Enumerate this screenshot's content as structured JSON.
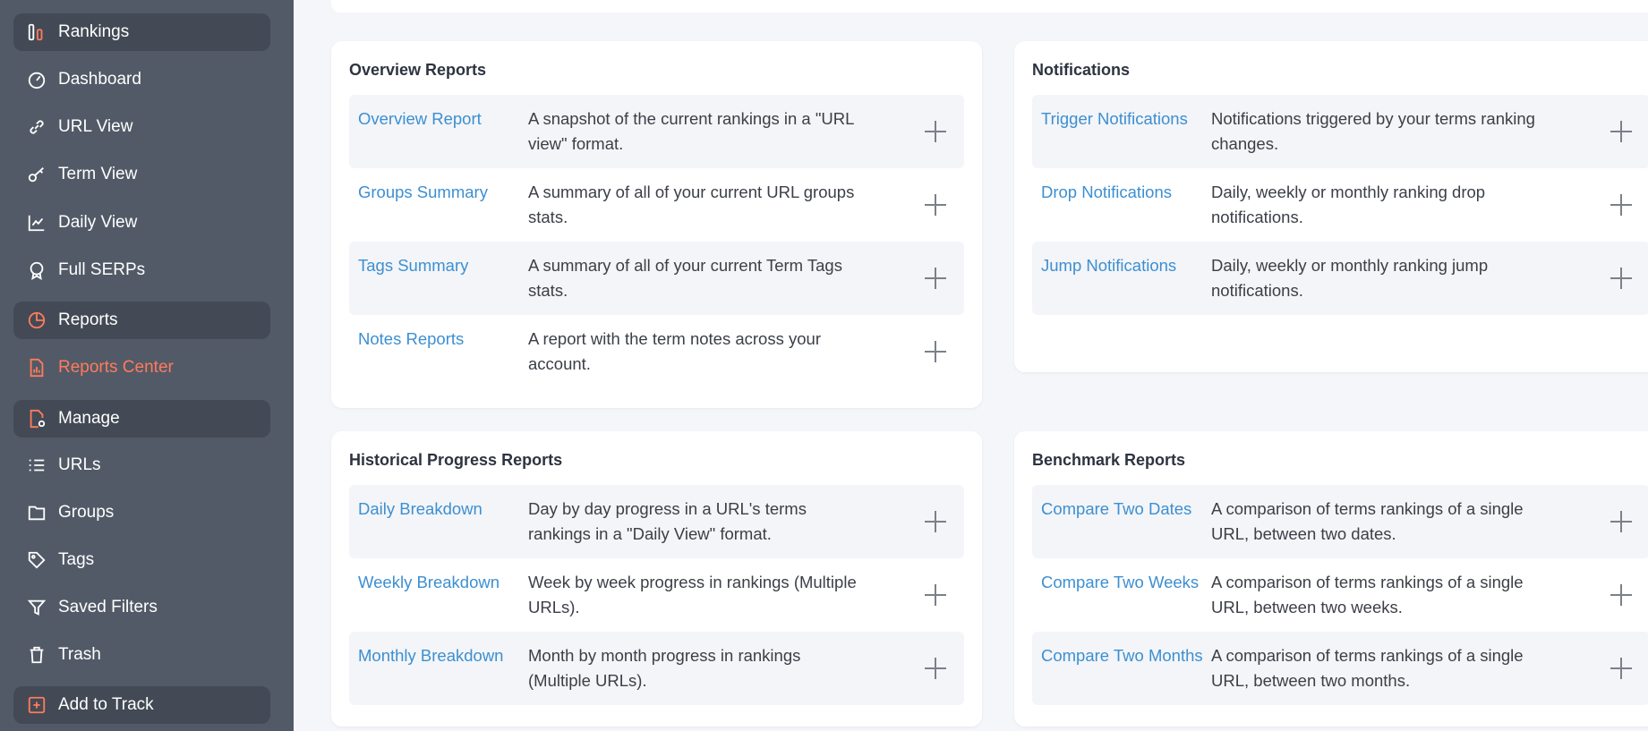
{
  "sidebar": {
    "items": [
      {
        "label": "Rankings",
        "icon": "rankings-icon"
      },
      {
        "label": "Dashboard",
        "icon": "dashboard-icon"
      },
      {
        "label": "URL View",
        "icon": "link-icon"
      },
      {
        "label": "Term View",
        "icon": "key-icon"
      },
      {
        "label": "Daily View",
        "icon": "chart-line-icon"
      },
      {
        "label": "Full SERPs",
        "icon": "serp-badge-icon"
      },
      {
        "label": "Reports",
        "icon": "pie-chart-icon"
      },
      {
        "label": "Reports Center",
        "icon": "report-document-icon"
      },
      {
        "label": "Manage",
        "icon": "manage-document-icon"
      },
      {
        "label": "URLs",
        "icon": "list-icon"
      },
      {
        "label": "Groups",
        "icon": "folder-icon"
      },
      {
        "label": "Tags",
        "icon": "tag-icon"
      },
      {
        "label": "Saved Filters",
        "icon": "filter-icon"
      },
      {
        "label": "Trash",
        "icon": "trash-icon"
      },
      {
        "label": "Add to Track",
        "icon": "add-square-icon"
      }
    ]
  },
  "colors": {
    "sidebar_bg": "#525a67",
    "sidebar_section_bg": "#434a55",
    "accent": "#ff7b5c",
    "link": "#3d8fd1"
  },
  "cards": {
    "overview": {
      "title": "Overview Reports",
      "rows": [
        {
          "link": "Overview Report",
          "desc": "A snapshot of the current rankings in a \"URL view\" format."
        },
        {
          "link": "Groups Summary",
          "desc": "A summary of all of your current URL groups stats."
        },
        {
          "link": "Tags Summary",
          "desc": "A summary of all of your current Term Tags stats."
        },
        {
          "link": "Notes Reports",
          "desc": "A report with the term notes across your account."
        }
      ]
    },
    "notifications": {
      "title": "Notifications",
      "rows": [
        {
          "link": "Trigger Notifications",
          "desc": "Notifications triggered by your terms ranking changes."
        },
        {
          "link": "Drop Notifications",
          "desc": "Daily, weekly or monthly ranking drop notifications."
        },
        {
          "link": "Jump Notifications",
          "desc": "Daily, weekly or monthly ranking jump notifications."
        }
      ]
    },
    "historical": {
      "title": "Historical Progress Reports",
      "rows": [
        {
          "link": "Daily Breakdown",
          "desc": "Day by day progress in a URL's terms rankings in a \"Daily View\" format."
        },
        {
          "link": "Weekly Breakdown",
          "desc": "Week by week progress in rankings (Multiple URLs)."
        },
        {
          "link": "Monthly Breakdown",
          "desc": "Month by month progress in rankings (Multiple URLs)."
        }
      ]
    },
    "benchmark": {
      "title": "Benchmark Reports",
      "rows": [
        {
          "link": "Compare Two Dates",
          "desc": "A comparison of terms rankings of a single URL, between two dates."
        },
        {
          "link": "Compare Two Weeks",
          "desc": "A comparison of terms rankings of a single URL, between two weeks."
        },
        {
          "link": "Compare Two Months",
          "desc": "A comparison of terms rankings of a single URL, between two months."
        }
      ]
    }
  }
}
